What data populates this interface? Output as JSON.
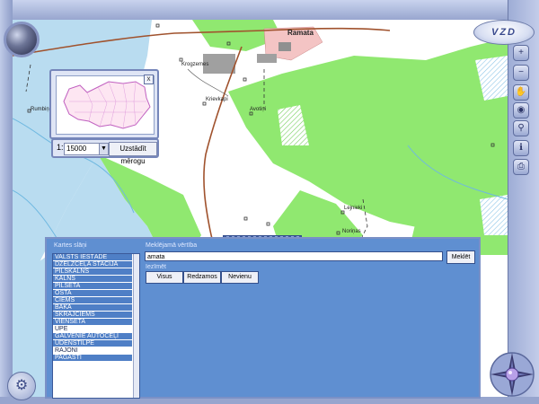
{
  "map": {
    "place_labels": [
      {
        "name": "Ramata",
        "bold": true
      },
      {
        "name": "Krogzemes"
      },
      {
        "name": "Krievkapi"
      },
      {
        "name": "Avotiņi"
      },
      {
        "name": "Rumbiņi"
      },
      {
        "name": "Lejnieki"
      },
      {
        "name": "Noriņas"
      },
      {
        "name": "Mestiņkalns"
      }
    ],
    "colors": {
      "forest": "#90e870",
      "swamp": "#b9dcf0",
      "road": "#a0522d",
      "settlement": "#f4c4c4"
    }
  },
  "brand": {
    "logo_text": "VZD"
  },
  "toolbar": {
    "tools": [
      {
        "name": "zoom-in-icon",
        "glyph": "+"
      },
      {
        "name": "zoom-out-icon",
        "glyph": "−"
      },
      {
        "name": "pan-hand-icon",
        "glyph": "✋"
      },
      {
        "name": "identify-icon",
        "glyph": "◉"
      },
      {
        "name": "measure-icon",
        "glyph": "⚲"
      },
      {
        "name": "info-icon",
        "glyph": "ℹ"
      },
      {
        "name": "print-icon",
        "glyph": "⎙"
      }
    ]
  },
  "overview": {
    "close_label": "x"
  },
  "scale": {
    "prefix": "1:",
    "value": "15000",
    "set_button": "Uzstādīt mērogu"
  },
  "search_panel": {
    "layers_label": "Kartes slāņi",
    "search_label": "Meklējamā vērtība",
    "search_value": "amata",
    "search_button": "Meklēt",
    "show_label": "Iezīmēt",
    "buttons": [
      "Visus",
      "Redzamos",
      "Nevienu"
    ],
    "layers": [
      {
        "label": "VALSTS IESTĀDE",
        "selected": true
      },
      {
        "label": "DZELZCEĻA STACIJA",
        "selected": true
      },
      {
        "label": "PILSKALNS",
        "selected": true
      },
      {
        "label": "KALNS",
        "selected": true
      },
      {
        "label": "PILSĒTA",
        "selected": true
      },
      {
        "label": "OSTA",
        "selected": true
      },
      {
        "label": "CIEMS",
        "selected": true
      },
      {
        "label": "BĀKA",
        "selected": true
      },
      {
        "label": "SKRAJCIEMS",
        "selected": true
      },
      {
        "label": "VIENSĒTA",
        "selected": true
      },
      {
        "label": "UPE",
        "selected": false
      },
      {
        "label": "GALVENIE AUTOCEĻI",
        "selected": true
      },
      {
        "label": "ŪDENSTILPE",
        "selected": true
      },
      {
        "label": "RAJONI",
        "selected": false
      },
      {
        "label": "PAGASTI",
        "selected": true
      }
    ]
  }
}
